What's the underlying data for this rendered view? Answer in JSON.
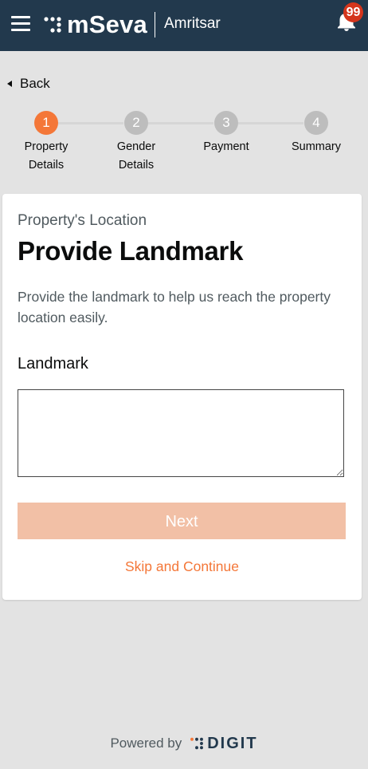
{
  "header": {
    "menu_icon": "hamburger-icon",
    "brand": "mSeva",
    "city": "Amritsar",
    "notification_icon": "bell-icon",
    "notification_count": "99",
    "colors": {
      "bar": "#22394d",
      "badge": "#d4351c"
    }
  },
  "nav": {
    "back_label": "Back"
  },
  "stepper": {
    "steps": [
      {
        "number": "1",
        "line1": "Property",
        "line2": "Details",
        "state": "active"
      },
      {
        "number": "2",
        "line1": "Gender",
        "line2": "Details",
        "state": "pending"
      },
      {
        "number": "3",
        "line1": "Payment",
        "line2": "",
        "state": "pending"
      },
      {
        "number": "4",
        "line1": "Summary",
        "line2": "",
        "state": "pending"
      }
    ],
    "colors": {
      "active": "#f47738",
      "pending": "#bdbdbd"
    }
  },
  "form": {
    "subheading": "Property's Location",
    "heading": "Provide Landmark",
    "description": "Provide the landmark to help us reach the property location easily.",
    "field_label": "Landmark",
    "field_value": "",
    "next_label": "Next",
    "skip_label": "Skip and Continue",
    "colors": {
      "next_bg_disabled": "#f2c0a6",
      "link": "#f47738"
    }
  },
  "footer": {
    "powered_by": "Powered by",
    "brand": "DIGIT"
  }
}
